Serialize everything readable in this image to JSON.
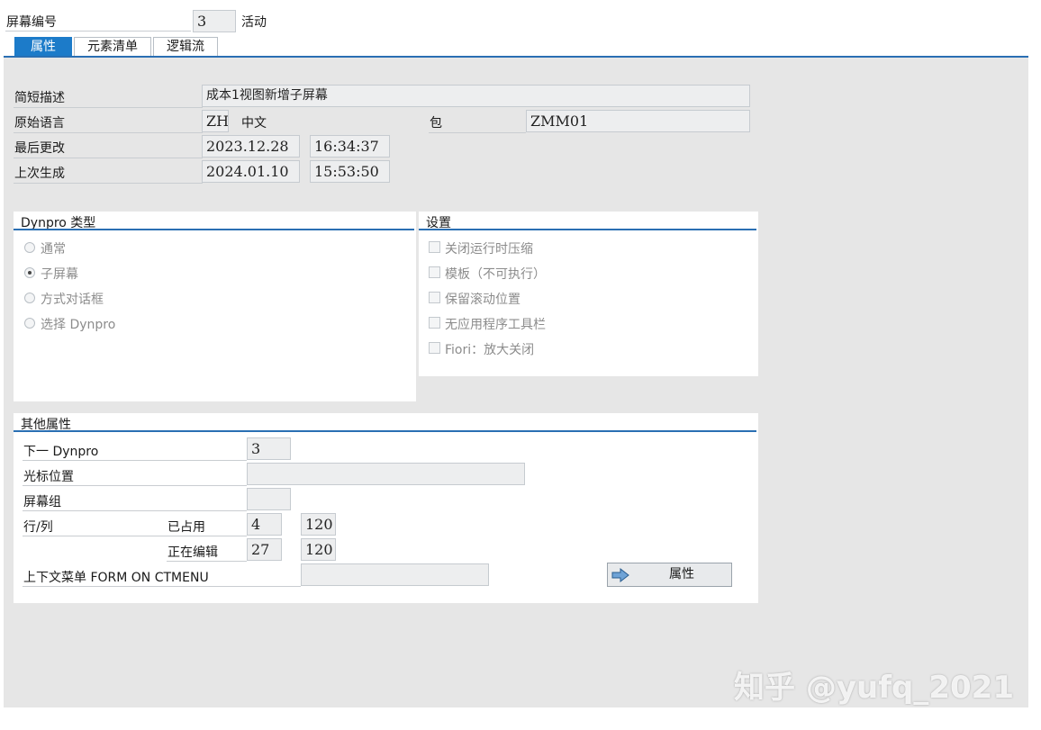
{
  "header": {
    "screen_number_label": "屏幕编号",
    "screen_number_value": "3",
    "status": "活动"
  },
  "tabs": [
    {
      "label": "属性",
      "active": true
    },
    {
      "label": "元素清单",
      "active": false
    },
    {
      "label": "逻辑流",
      "active": false
    }
  ],
  "attributes": {
    "short_desc_label": "简短描述",
    "short_desc_value": "成本1视图新增子屏幕",
    "orig_lang_label": "原始语言",
    "orig_lang_code": "ZH",
    "orig_lang_name": "中文",
    "package_label": "包",
    "package_value": "ZMM01",
    "last_changed_label": "最后更改",
    "last_changed_date": "2023.12.28",
    "last_changed_time": "16:34:37",
    "last_generated_label": "上次生成",
    "last_generated_date": "2024.01.10",
    "last_generated_time": "15:53:50"
  },
  "dynpro_type": {
    "title": "Dynpro 类型",
    "options": [
      {
        "label": "通常",
        "selected": false
      },
      {
        "label": "子屏幕",
        "selected": true
      },
      {
        "label": "方式对话框",
        "selected": false
      },
      {
        "label": "选择 Dynpro",
        "selected": false
      }
    ]
  },
  "settings": {
    "title": "设置",
    "options": [
      {
        "label": "关闭运行时压缩",
        "checked": false
      },
      {
        "label": "模板（不可执行）",
        "checked": false
      },
      {
        "label": "保留滚动位置",
        "checked": false
      },
      {
        "label": "无应用程序工具栏",
        "checked": false
      },
      {
        "label": "Fiori：放大关闭",
        "checked": false
      }
    ]
  },
  "other": {
    "title": "其他属性",
    "next_dynpro_label": "下一 Dynpro",
    "next_dynpro_value": "3",
    "cursor_pos_label": "光标位置",
    "cursor_pos_value": "",
    "screen_group_label": "屏幕组",
    "screen_group_value": "",
    "rows_cols_label": "行/列",
    "used_label": "已占用",
    "used_rows": "4",
    "used_cols": "120",
    "editing_label": "正在编辑",
    "editing_rows": "27",
    "editing_cols": "120",
    "context_menu_label": "上下文菜单 FORM ON CTMENU",
    "context_menu_value": "",
    "attr_button_label": "属性"
  },
  "watermark": "知乎 @yufq_2021",
  "colors": {
    "accent": "#2a6fb3",
    "active_tab": "#1c7bc9",
    "background": "#e6e6e6",
    "field_bg": "#edeeef"
  },
  "icons": {
    "attr_button_icon": "arrow-right-icon"
  }
}
